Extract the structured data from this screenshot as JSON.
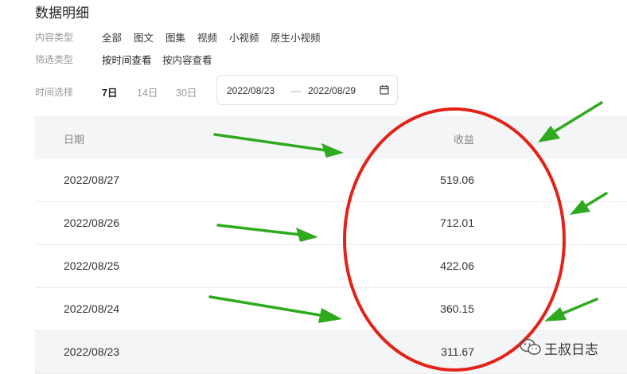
{
  "page": {
    "title": "数据明细"
  },
  "filters": {
    "content_type_label": "内容类型",
    "content_types": [
      "全部",
      "图文",
      "图集",
      "视频",
      "小视频",
      "原生小视频"
    ],
    "filter_type_label": "筛选类型",
    "filter_types": [
      "按时间查看",
      "按内容查看"
    ],
    "time_label": "时间选择",
    "time_ranges": [
      "7日",
      "14日",
      "30日"
    ],
    "selected_time_range": "7日",
    "date_start": "2022/08/23",
    "date_sep": "—",
    "date_end": "2022/08/29"
  },
  "table": {
    "headers": {
      "date": "日期",
      "earnings": "收益"
    },
    "rows": [
      {
        "date": "2022/08/27",
        "earnings": "519.06"
      },
      {
        "date": "2022/08/26",
        "earnings": "712.01"
      },
      {
        "date": "2022/08/25",
        "earnings": "422.06"
      },
      {
        "date": "2022/08/24",
        "earnings": "360.15"
      },
      {
        "date": "2022/08/23",
        "earnings": "311.67"
      }
    ]
  },
  "watermark": {
    "text": "王叔日志"
  },
  "annotations": {
    "arrow_color": "#2faa1e",
    "ellipse_color": "#e32219"
  }
}
